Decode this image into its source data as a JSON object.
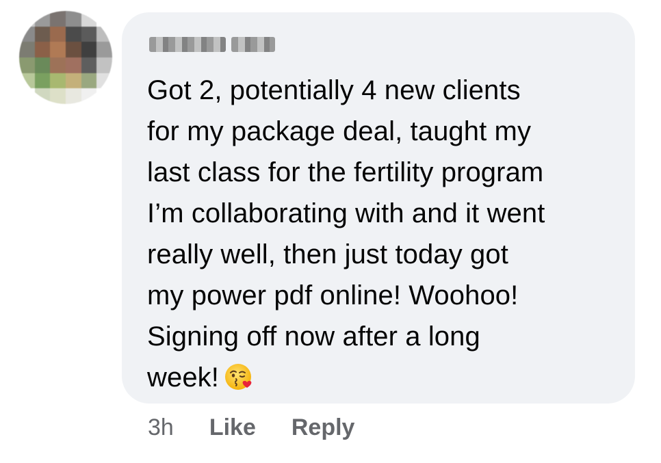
{
  "comment": {
    "body_lines": [
      "Got 2, potentially 4 new clients",
      "for my package deal, taught my",
      "last class for the fertility program",
      "I’m collaborating with and it went",
      "really well, then just today got",
      "my power pdf online! Woohoo!",
      "Signing off now after a long",
      "week!"
    ],
    "emoji": "face-blowing-a-kiss-emoji",
    "time": "3h",
    "like_label": "Like",
    "reply_label": "Reply"
  },
  "colors": {
    "bubble_bg": "#f0f2f5",
    "text": "#050505",
    "meta": "#65676b"
  }
}
